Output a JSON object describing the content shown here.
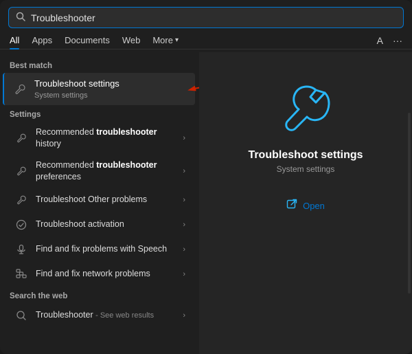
{
  "search": {
    "placeholder": "Troubleshooter",
    "value": "Troubleshooter"
  },
  "tabs": {
    "items": [
      {
        "id": "all",
        "label": "All",
        "active": true
      },
      {
        "id": "apps",
        "label": "Apps",
        "active": false
      },
      {
        "id": "documents",
        "label": "Documents",
        "active": false
      },
      {
        "id": "web",
        "label": "Web",
        "active": false
      },
      {
        "id": "more",
        "label": "More",
        "active": false
      }
    ],
    "right_a": "A",
    "right_more": "···"
  },
  "left": {
    "best_match_label": "Best match",
    "best_match": {
      "title": "Troubleshoot settings",
      "subtitle": "System settings"
    },
    "settings_label": "Settings",
    "settings_items": [
      {
        "icon": "wrench",
        "text_before": "Recommended ",
        "text_bold": "troubleshooter",
        "text_after": " history",
        "has_chevron": true
      },
      {
        "icon": "wrench",
        "text_before": "Recommended ",
        "text_bold": "troubleshooter",
        "text_after": " preferences",
        "has_chevron": true
      },
      {
        "icon": "wrench",
        "text_before": "Troubleshoot Other problems",
        "text_bold": "",
        "text_after": "",
        "has_chevron": true
      },
      {
        "icon": "shield",
        "text_before": "Troubleshoot activation",
        "text_bold": "",
        "text_after": "",
        "has_chevron": true
      },
      {
        "icon": "mic",
        "text_before": "Find and fix problems with Speech",
        "text_bold": "",
        "text_after": "",
        "has_chevron": true
      },
      {
        "icon": "network",
        "text_before": "Find and fix network problems",
        "text_bold": "",
        "text_after": "",
        "has_chevron": true
      }
    ],
    "web_label": "Search the web",
    "web_item": {
      "text": "Troubleshooter",
      "sub": "See web results",
      "has_chevron": true
    }
  },
  "right": {
    "title": "Troubleshoot settings",
    "subtitle": "System settings",
    "open_label": "Open"
  }
}
